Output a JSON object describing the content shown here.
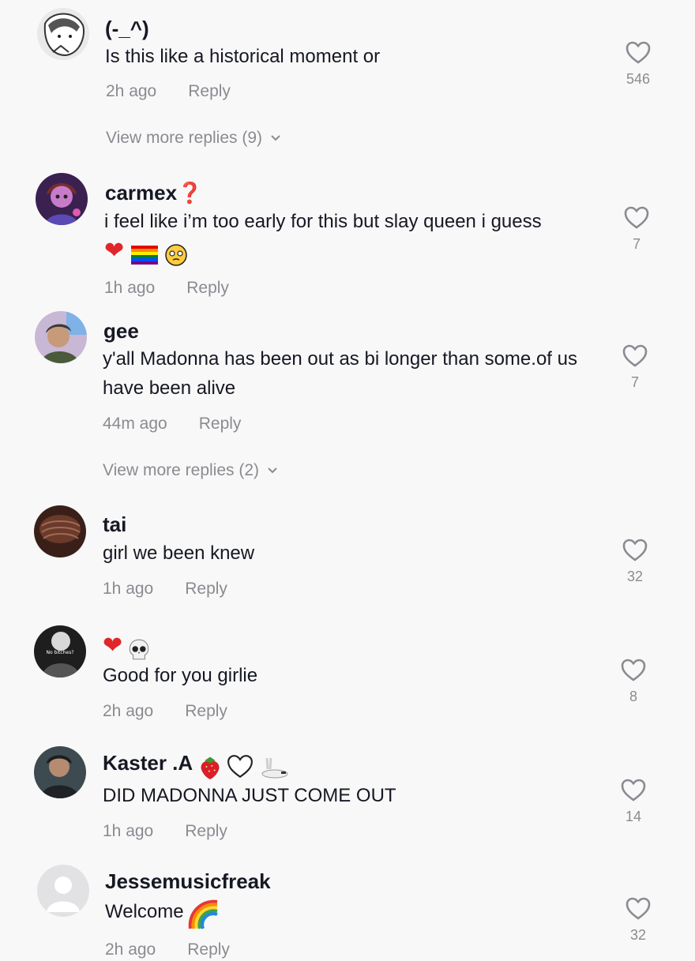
{
  "comments": [
    {
      "username": "(-_^)",
      "text": "Is this like a historical moment or",
      "time": "2h ago",
      "reply_label": "Reply",
      "likes": "546",
      "more_replies": "View more replies (9)"
    },
    {
      "username": "carmex❓",
      "text": "i feel like i’m too early for this but slay queen i guess",
      "emoji_line": [
        "❤️",
        "🏳️‍🌈",
        "🥹"
      ],
      "time": "1h ago",
      "reply_label": "Reply",
      "likes": "7"
    },
    {
      "username": "gee",
      "text": "y'all Madonna has been out as bi longer than some.of us have been alive",
      "time": "44m ago",
      "reply_label": "Reply",
      "likes": "7",
      "more_replies": "View more replies (2)"
    },
    {
      "username": "tai",
      "text": "girl we been knew",
      "time": "1h ago",
      "reply_label": "Reply",
      "likes": "32"
    },
    {
      "username_emoji": [
        "❤️",
        "💀"
      ],
      "text": "Good for you girlie",
      "time": "2h ago",
      "reply_label": "Reply",
      "likes": "8",
      "avatar_text": "No bitches?"
    },
    {
      "username": "Kaster .A",
      "username_suffix": [
        "🍓",
        "♡",
        "🐇"
      ],
      "text": "DID MADONNA JUST COME OUT",
      "time": "1h ago",
      "reply_label": "Reply",
      "likes": "14"
    },
    {
      "username": "Jessemusicfreak",
      "text": "Welcome",
      "text_emoji": "🌈",
      "time": "2h ago",
      "reply_label": "Reply",
      "likes": "32"
    }
  ],
  "colors": {
    "background": "#f8f8f8",
    "primary_text": "#161823",
    "secondary_text": "#8a8b91",
    "like_icon": "#8a8b91"
  }
}
